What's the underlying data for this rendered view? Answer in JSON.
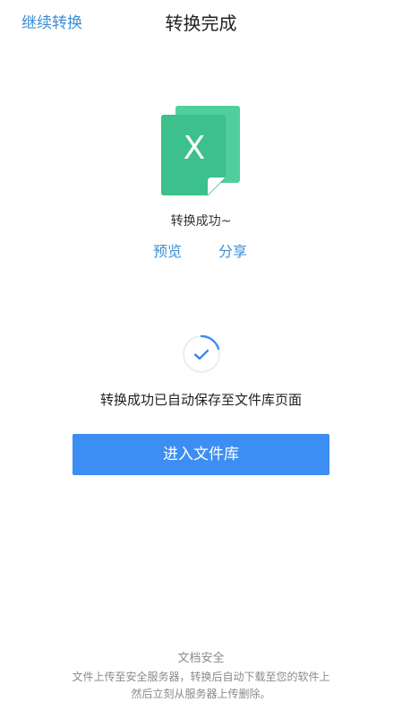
{
  "header": {
    "back_label": "继续转换",
    "title": "转换完成"
  },
  "file": {
    "icon": "excel-file-icon",
    "icon_letter": "X",
    "color": "#3cc08c",
    "status_text": "转换成功~"
  },
  "actions": {
    "preview_label": "预览",
    "share_label": "分享"
  },
  "saved": {
    "icon": "check-circle-icon",
    "message": "转换成功已自动保存至文件库页面"
  },
  "primary_button": {
    "label": "进入文件库",
    "color": "#3d8ef2"
  },
  "security": {
    "title": "文档安全",
    "line1": "文件上传至安全服务器，转换后自动下载至您的软件上",
    "line2": "然后立刻从服务器上传删除。"
  },
  "colors": {
    "link": "#3a8fd6",
    "accent_green": "#3cc08c"
  }
}
